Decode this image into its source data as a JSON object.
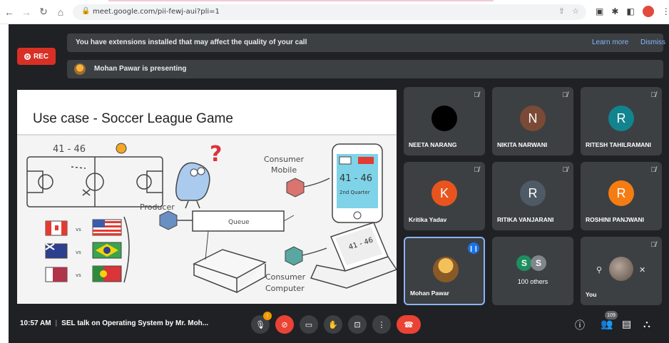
{
  "browser": {
    "url": "meet.google.com/pii-fewj-aui?pli=1",
    "nav_icons": [
      "back-icon",
      "forward-icon",
      "reload-icon",
      "home-icon"
    ]
  },
  "recording": {
    "label": "REC"
  },
  "banner": {
    "message": "You have extensions installed that may affect the quality of your call",
    "learn_more": "Learn more",
    "dismiss": "Dismiss"
  },
  "presenting": {
    "text": "Mohan Pawar is presenting"
  },
  "slide": {
    "title": "Use case - Soccer League Game",
    "score": "41 - 46",
    "quarter": "2nd Quarter",
    "labels": {
      "producer": "Producer",
      "queue": "Queue",
      "consumer_mobile": [
        "Consumer",
        "Mobile"
      ],
      "consumer_computer": [
        "Consumer",
        "Computer"
      ],
      "vs": "vs"
    }
  },
  "participants": [
    {
      "name": "NEETA NARANG",
      "initial": "",
      "color": "#000000"
    },
    {
      "name": "NIKITA NARWANI",
      "initial": "N",
      "color": "#7a4a36"
    },
    {
      "name": "RITESH TAHILRAMANI",
      "initial": "R",
      "color": "#12848f"
    },
    {
      "name": "Kritika Yadav",
      "initial": "K",
      "color": "#e8541e"
    },
    {
      "name": "RITIKA VANJARANI",
      "initial": "R",
      "color": "#4e5a66"
    },
    {
      "name": "ROSHINI PANJWANI",
      "initial": "R",
      "color": "#f57c12"
    },
    {
      "name": "Mohan Pawar",
      "initial": "",
      "color": "#c9842c"
    }
  ],
  "others": {
    "label": "100 others",
    "initials": [
      "S",
      "S"
    ]
  },
  "you": {
    "label": "You"
  },
  "bottom": {
    "time": "10:57 AM",
    "separator": "|",
    "meeting_title": "SEL talk on Operating System by Mr. Moh...",
    "mic_badge": "!",
    "participant_count": "109"
  },
  "colors": {
    "meet_bg": "#202124",
    "tile_bg": "#3c4043",
    "red": "#ea4335",
    "link": "#8ab4f8"
  }
}
